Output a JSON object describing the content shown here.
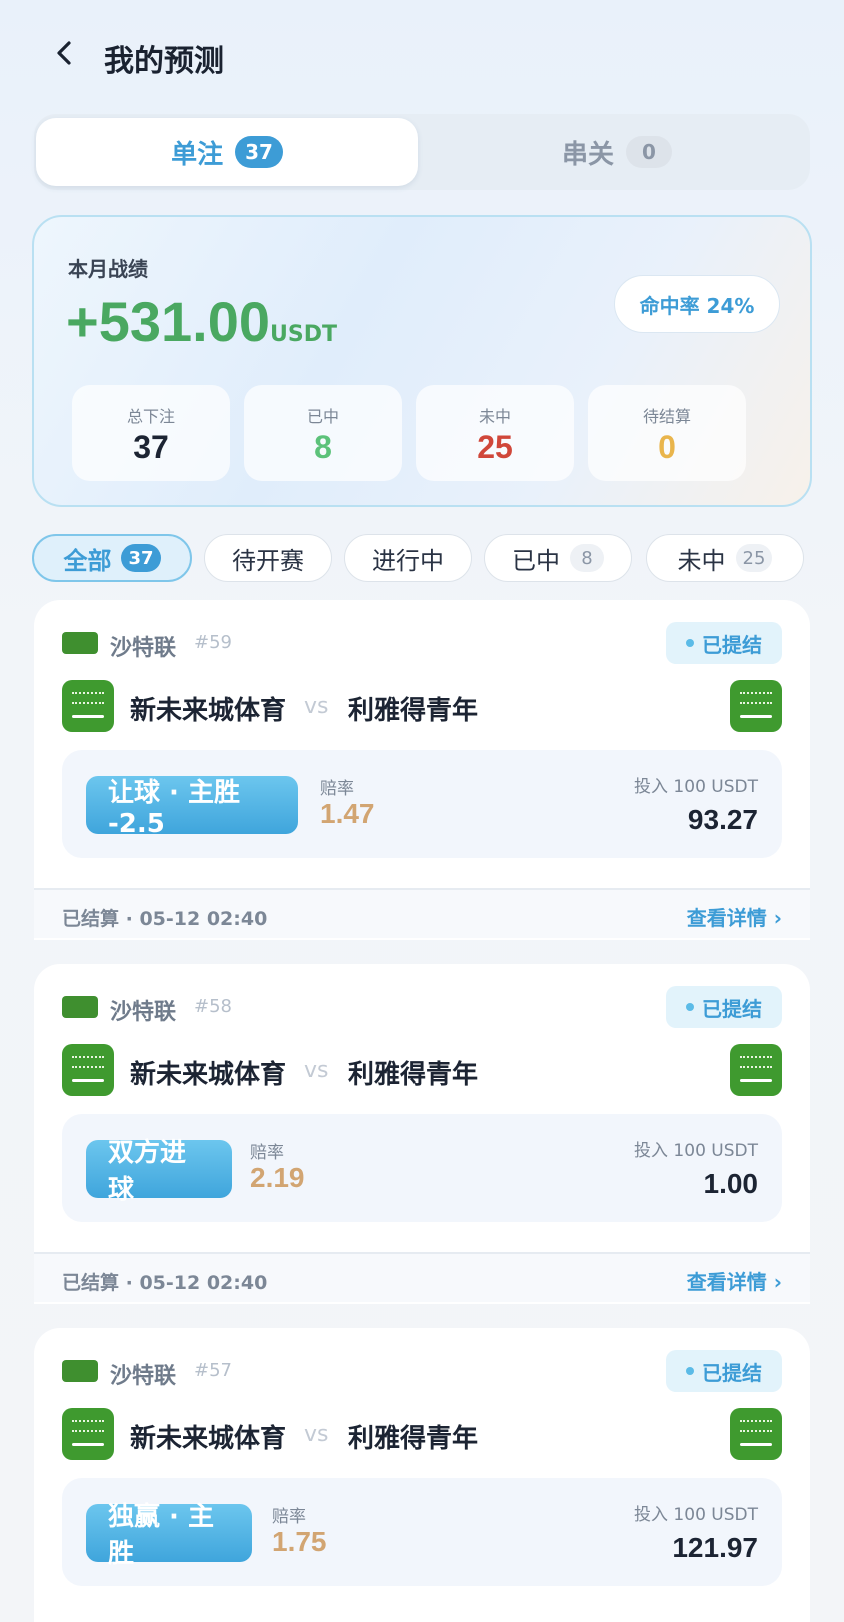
{
  "header": {
    "title": "我的预测"
  },
  "segments": [
    {
      "label": "单注",
      "count": "37",
      "active": true
    },
    {
      "label": "串关",
      "count": "0",
      "active": false
    }
  ],
  "stats": {
    "label": "本月战绩",
    "amount": "+531.00",
    "unit": "USDT",
    "hit_rate": "命中率 24%",
    "boxes": [
      {
        "label": "总下注",
        "value": "37",
        "color": "#1c2433"
      },
      {
        "label": "已中",
        "value": "8",
        "color": "#5cc27a"
      },
      {
        "label": "未中",
        "value": "25",
        "color": "#d0473a"
      },
      {
        "label": "待结算",
        "value": "0",
        "color": "#e9b54c"
      }
    ]
  },
  "filters": [
    {
      "label": "全部",
      "count": "37",
      "active": true
    },
    {
      "label": "待开赛",
      "count": ""
    },
    {
      "label": "进行中",
      "count": ""
    },
    {
      "label": "已中",
      "count": "8"
    },
    {
      "label": "未中",
      "count": "25"
    }
  ],
  "cards": [
    {
      "league": "沙特联",
      "match_no": "#59",
      "status": "已提结",
      "home": "新未来城体育",
      "vs": "vs",
      "away": "利雅得青年",
      "pick": "让球 · 主胜 -2.5",
      "odds_label": "赔率",
      "odds": "1.47",
      "stake": "投入 100 USDT",
      "payout": "93.27",
      "settled": "已结算 · 05-12 02:40",
      "detail": "查看详情 ›"
    },
    {
      "league": "沙特联",
      "match_no": "#58",
      "status": "已提结",
      "home": "新未来城体育",
      "vs": "vs",
      "away": "利雅得青年",
      "pick": "双方进球",
      "odds_label": "赔率",
      "odds": "2.19",
      "stake": "投入 100 USDT",
      "payout": "1.00",
      "settled": "已结算 · 05-12 02:40",
      "detail": "查看详情 ›"
    },
    {
      "league": "沙特联",
      "match_no": "#57",
      "status": "已提结",
      "home": "新未来城体育",
      "vs": "vs",
      "away": "利雅得青年",
      "pick": "独赢 · 主胜",
      "odds_label": "赔率",
      "odds": "1.75",
      "stake": "投入 100 USDT",
      "payout": "121.97",
      "settled": "",
      "detail": ""
    }
  ],
  "icons": {
    "back": "chevron-left-icon",
    "flag": "saudi-flag-icon"
  }
}
